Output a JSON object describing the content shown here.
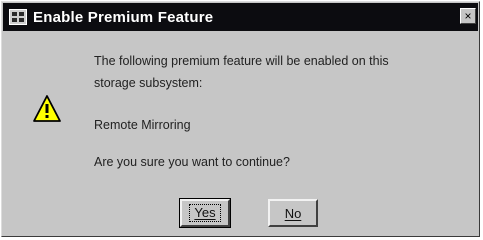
{
  "dialog": {
    "title": "Enable Premium Feature",
    "close_glyph": "×",
    "icon": "warning-icon",
    "message_line1": "The following premium feature will be enabled on this",
    "message_line2": "storage subsystem:",
    "feature_name": "Remote Mirroring",
    "question": "Are you sure you want to continue?"
  },
  "buttons": {
    "yes_label": "Yes",
    "no_label": "No"
  },
  "colors": {
    "titlebar": "#0c0c10",
    "dialog_bg": "#c6c6c6",
    "warning_fill": "#ffff00"
  }
}
